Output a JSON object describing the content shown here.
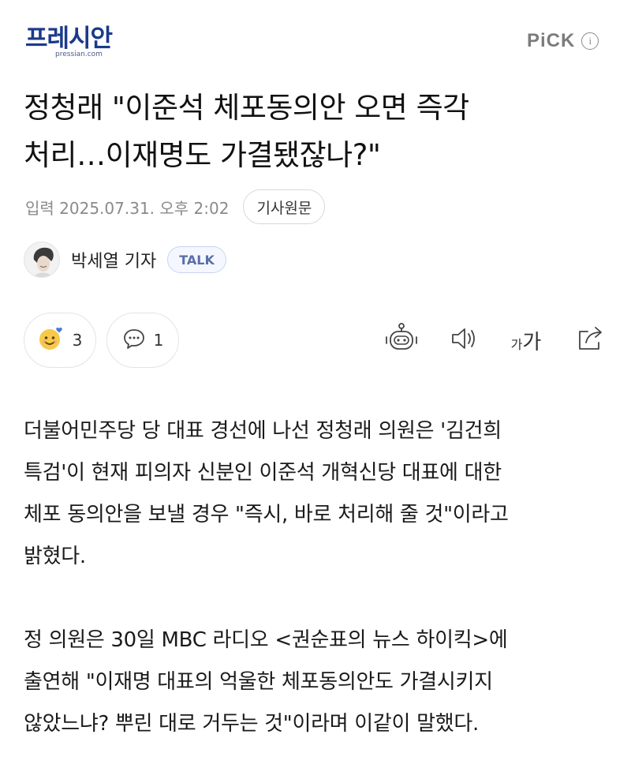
{
  "header": {
    "logo_text": "프레시안",
    "logo_sub": "pressian.com",
    "pick_label": "PiCK",
    "info_icon": "i"
  },
  "article": {
    "headline_line1": "정청래 \"이준석 체포동의안 오면 즉각",
    "headline_line2": "처리…이재명도 가결됐잖나?\"",
    "date": "입력 2025.07.31. 오후 2:02",
    "origin_button": "기사원문",
    "reporter": "박세열 기자",
    "talk_button": "TALK",
    "reaction_count": "3",
    "comment_count": "1",
    "font_size_label_small": "가",
    "font_size_label_large": "가",
    "paragraph1_line1": "더불어민주당 당 대표 경선에 나선 정청래 의원은 '김건희",
    "paragraph1_line2": "특검'이 현재 피의자 신분인 이준석 개혁신당 대표에 대한",
    "paragraph1_line3": "체포 동의안을 보낼 경우 \"즉시, 바로 처리해 줄 것\"이라고",
    "paragraph1_line4": "밝혔다.",
    "paragraph2_line1": "정 의원은 30일 MBC 라디오 <권순표의 뉴스 하이킥>에",
    "paragraph2_line2": "출연해 \"이재명 대표의 억울한 체포동의안도 가결시키지",
    "paragraph2_line3": "않았느냐? 뿌린 대로 거두는 것\"이라며 이같이 말했다."
  },
  "icons": {
    "reaction": "smile-emoji-icon",
    "comment": "comment-bubble-icon",
    "robot": "robot-summary-icon",
    "speaker": "speaker-icon",
    "font_size": "font-size-icon",
    "share": "share-icon"
  },
  "colors": {
    "logo": "#1b3a8c",
    "pick": "#7c7c7c",
    "talk_border": "#c9d4f0",
    "emoji_face": "#f7c948",
    "emoji_heart": "#3d7be0"
  }
}
